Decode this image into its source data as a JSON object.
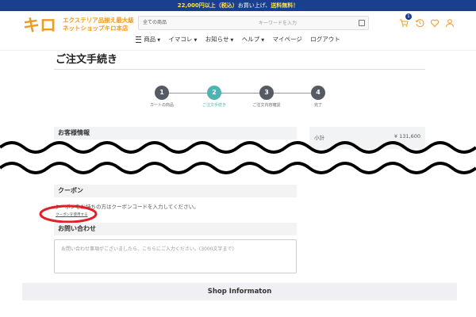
{
  "promo": {
    "highlight1": "22,000円以上（税込）",
    "text1": "お買い上げ、",
    "highlight2": "送料無料！"
  },
  "logo": {
    "mark": "キロ",
    "line1": "エクステリア品揃え最大級",
    "line2": "ネットショップキロ本店"
  },
  "search": {
    "category": "全ての商品",
    "placeholder": "キーワードを入力"
  },
  "cart": {
    "count": "1"
  },
  "nav": [
    {
      "label": "商品"
    },
    {
      "label": "イマコレ"
    },
    {
      "label": "お知らせ"
    },
    {
      "label": "ヘルプ"
    },
    {
      "label": "マイページ"
    },
    {
      "label": "ログアウト"
    }
  ],
  "page": {
    "title": "ご注文手続き"
  },
  "steps": [
    {
      "num": "1",
      "label": "カートの商品"
    },
    {
      "num": "2",
      "label": "ご注文手続き"
    },
    {
      "num": "3",
      "label": "ご注文内容確認"
    },
    {
      "num": "4",
      "label": "完了"
    }
  ],
  "customer": {
    "heading": "お客様情報"
  },
  "summary": {
    "label": "小計",
    "value": "¥ 131,600"
  },
  "coupon": {
    "heading": "クーポン",
    "text": "クーポンをお持ちの方はクーポンコードを入力してください。",
    "link": "クーポンを使用する"
  },
  "inquiry": {
    "heading": "お問い合わせ",
    "placeholder": "お問い合わせ事項がございましたら、こちらにご入力ください。(3000文字まで)"
  },
  "footer": {
    "shop_info": "Shop Informaton"
  },
  "colors": {
    "brand_orange": "#f09a1e",
    "nav_blue": "#1b3f8f",
    "step_active": "#4fb3b3",
    "annotation_red": "#e31e24"
  }
}
